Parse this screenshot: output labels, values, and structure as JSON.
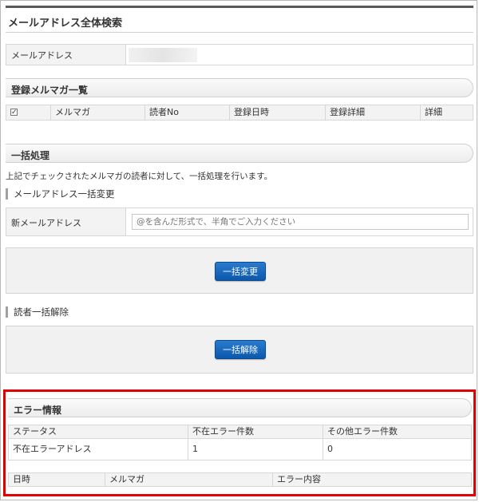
{
  "page": {
    "title": "メールアドレス全体検索"
  },
  "email_search": {
    "label": "メールアドレス",
    "value_masked": true
  },
  "magazine_list": {
    "heading": "登録メルマガ一覧",
    "columns": [
      "",
      "メルマガ",
      "読者No",
      "登録日時",
      "登録詳細",
      "詳細"
    ],
    "checkbox_checked": true,
    "checkbox_mark": "✓"
  },
  "bulk": {
    "heading": "一括処理",
    "description": "上記でチェックされたメルマガの読者に対して、一括処理を行います。",
    "change": {
      "subheading": "メールアドレス一括変更",
      "field_label": "新メールアドレス",
      "placeholder": "@を含んだ形式で、半角でご入力ください",
      "button": "一括変更"
    },
    "cancel": {
      "subheading": "読者一括解除",
      "button": "一括解除"
    }
  },
  "errors": {
    "heading": "エラー情報",
    "summary_headers": [
      "ステータス",
      "不在エラー件数",
      "その他エラー件数"
    ],
    "summary_row": [
      "不在エラーアドレス",
      "1",
      "0"
    ],
    "detail_headers": [
      "日時",
      "メルマガ",
      "エラー内容"
    ],
    "highlight_color": "#e00000"
  },
  "colors": {
    "button": "#1565c0",
    "topbar": "#5a5a5a"
  }
}
